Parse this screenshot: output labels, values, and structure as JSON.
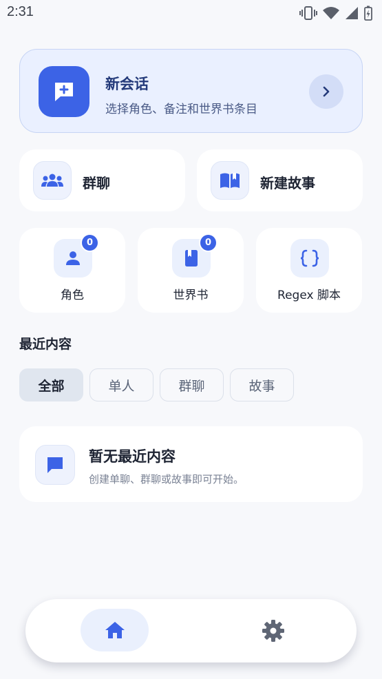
{
  "status_bar": {
    "time": "2:31",
    "icons": [
      "vibrate-icon",
      "wifi-icon",
      "signal-icon",
      "battery-charging-icon"
    ]
  },
  "new_chat": {
    "title": "新会话",
    "subtitle": "选择角色、备注和世界书条目",
    "icon": "chat-add-icon",
    "arrow_icon": "chevron-right-icon"
  },
  "quick_actions": [
    {
      "label": "群聊",
      "icon": "group-icon"
    },
    {
      "label": "新建故事",
      "icon": "book-open-icon"
    }
  ],
  "shortcuts": [
    {
      "label": "角色",
      "icon": "person-icon",
      "count": "0"
    },
    {
      "label": "世界书",
      "icon": "book-icon",
      "count": "0"
    },
    {
      "label": "Regex 脚本",
      "icon": "braces-icon"
    }
  ],
  "recent": {
    "title": "最近内容",
    "filters": [
      "全部",
      "单人",
      "群聊",
      "故事"
    ],
    "selected_filter": "全部",
    "empty_title": "暂无最近内容",
    "empty_subtitle": "创建单聊、群聊或故事即可开始。",
    "empty_icon": "chat-bubble-icon"
  },
  "bottom_nav": {
    "items": [
      {
        "icon": "home-icon",
        "active": true
      },
      {
        "icon": "settings-gear-icon",
        "active": false
      }
    ]
  },
  "colors": {
    "accent": "#3c63e6",
    "hero_bg": "#eaf0ff",
    "page_bg": "#f7f8fb",
    "icon_tile_bg": "#eaf0fd"
  }
}
